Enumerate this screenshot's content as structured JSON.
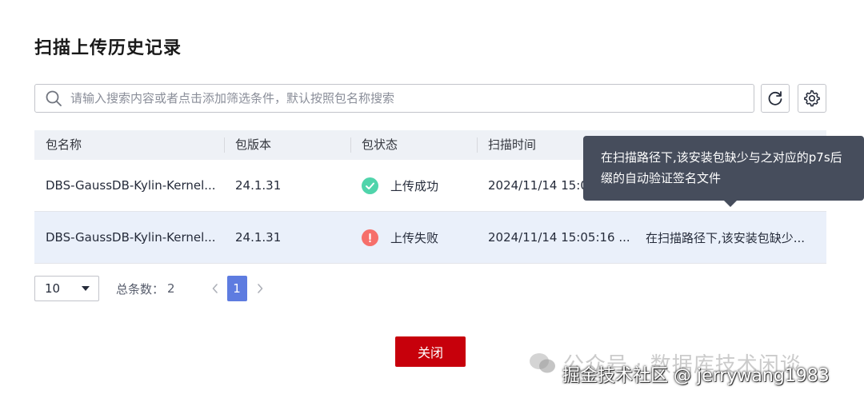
{
  "dialog": {
    "title": "扫描上传历史记录",
    "search": {
      "placeholder": "请输入搜索内容或者点击添加筛选条件，默认按照包名称搜索",
      "value": ""
    },
    "refresh_icon": "refresh-icon",
    "settings_icon": "gear-icon",
    "table": {
      "columns": [
        "包名称",
        "包版本",
        "包状态",
        "扫描时间",
        ""
      ],
      "rows": [
        {
          "name": "DBS-GaussDB-Kylin-Kernel...",
          "version": "24.1.31",
          "status": "上传成功",
          "status_type": "success",
          "time": "2024/11/14 15:0",
          "detail": ""
        },
        {
          "name": "DBS-GaussDB-Kylin-Kernel...",
          "version": "24.1.31",
          "status": "上传失败",
          "status_type": "error",
          "time": "2024/11/14 15:05:16 ...",
          "detail": "在扫描路径下,该安装包缺少..."
        }
      ]
    },
    "tooltip": {
      "line1": "在扫描路径下,该安装包缺少与之对应的p7s后",
      "line2": "缀的自动验证签名文件"
    },
    "pagination": {
      "page_size": "10",
      "total_label": "总条数：",
      "total_value": "2",
      "current_page": "1"
    },
    "close_label": "关闭"
  },
  "watermark": {
    "line1": "公众号 · 数据库技术闲谈",
    "line2": "掘金技术社区 @ jerrywang1983"
  },
  "colors": {
    "accent": "#5e7ce0",
    "danger_button": "#c7000b",
    "success": "#50d4ab",
    "error": "#f66f6a",
    "tooltip_bg": "#464d5c"
  }
}
